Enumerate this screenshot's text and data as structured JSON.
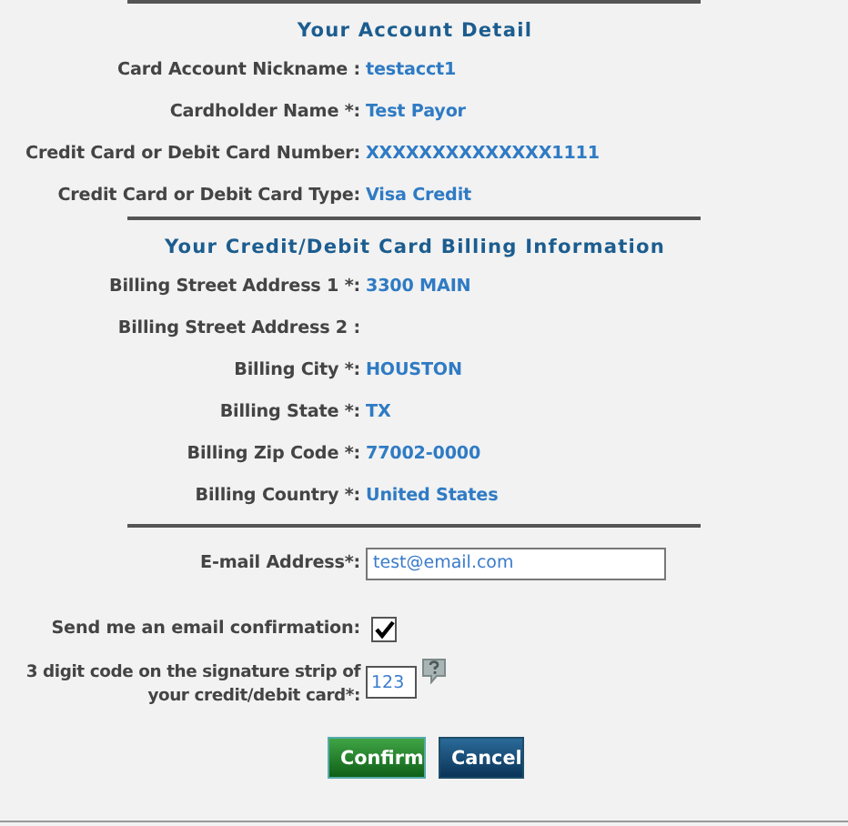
{
  "sections": [
    {
      "heading": "Your Account Detail",
      "rows": [
        {
          "label": "Card Account Nickname :",
          "value": "testacct1"
        },
        {
          "label": "Cardholder Name *:",
          "value": "Test Payor"
        },
        {
          "label": "Credit Card or Debit Card Number:",
          "value": "XXXXXXXXXXXXXX1111"
        },
        {
          "label": "Credit Card or Debit Card Type:",
          "value": "Visa Credit"
        }
      ]
    },
    {
      "heading": "Your Credit/Debit Card Billing Information",
      "rows": [
        {
          "label": "Billing Street Address 1 *:",
          "value": "3300 MAIN"
        },
        {
          "label": "Billing Street Address 2 :"
        },
        {
          "label": "Billing City *:",
          "value": "HOUSTON"
        },
        {
          "label": "Billing State *:",
          "value": "TX"
        },
        {
          "label": "Billing Zip Code *:",
          "value": "77002-0000"
        },
        {
          "label": "Billing Country *:",
          "value": "United States"
        }
      ]
    }
  ],
  "email": {
    "label": "E-mail Address*:",
    "value": "test@email.com"
  },
  "confirmation": {
    "label": "Send me an email confirmation:",
    "checked": true
  },
  "code": {
    "label_lines": [
      "3 digit code on the signature strip of",
      "your credit/debit card*:"
    ],
    "value": "123"
  },
  "buttons": [
    {
      "label": "Confirm",
      "kind": "primary"
    },
    {
      "label": "Cancel",
      "kind": "secondary"
    }
  ]
}
